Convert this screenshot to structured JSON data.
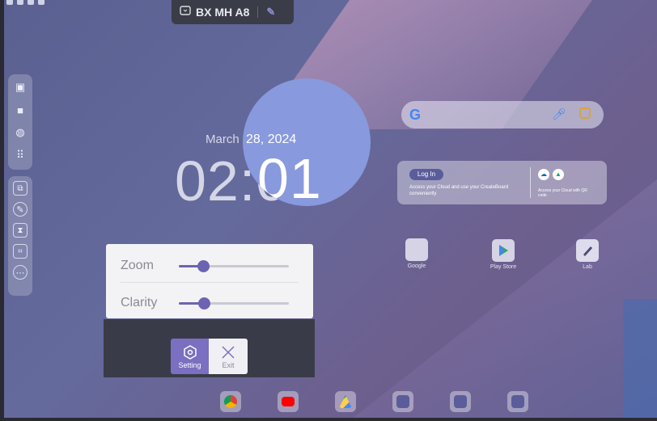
{
  "header": {
    "title": "BX MH A8",
    "title_icon": "presentation-icon",
    "edit_icon": "edit-pencil-icon"
  },
  "sidebar_top": [
    {
      "icon": "note-icon"
    },
    {
      "icon": "folder-icon"
    },
    {
      "icon": "globe-icon"
    },
    {
      "icon": "apps-grid-icon"
    }
  ],
  "sidebar_tools": [
    {
      "icon": "window-icon"
    },
    {
      "icon": "pen-icon"
    },
    {
      "icon": "hourglass-icon"
    },
    {
      "icon": "screenshot-icon"
    },
    {
      "icon": "more-icon"
    }
  ],
  "clock": {
    "date": "March 28, 2024",
    "time": "02:01",
    "magnified_date": "28, 2024",
    "magnified_time": "01"
  },
  "search_widget": {
    "logo": "G",
    "mic_icon": "mic-icon",
    "lens_icon": "lens-icon"
  },
  "cloud_card": {
    "login_label": "Log In",
    "description": "Access your Cloud and use your CreateBoard conveniently",
    "qr_note": "Access your Cloud with QR code"
  },
  "apps": [
    {
      "label": "Google",
      "icon": "google-folder-icon"
    },
    {
      "label": "Play Store",
      "icon": "play-store-icon"
    },
    {
      "label": "Lab",
      "icon": "lab-pen-icon"
    }
  ],
  "magnifier_panel": {
    "zoom_label": "Zoom",
    "zoom_level": 0.22,
    "clarity_label": "Clarity",
    "clarity_level": 0.23
  },
  "toolbar": {
    "setting_label": "Setting",
    "exit_label": "Exit"
  },
  "dock": [
    {
      "icon": "chrome-icon",
      "color": "#db4437"
    },
    {
      "icon": "youtube-icon",
      "color": "#ff0000"
    },
    {
      "icon": "drive-icon",
      "color": "#1fa463"
    },
    {
      "icon": "whiteboard-icon",
      "color": "#5a5d9a"
    },
    {
      "icon": "screen-share-icon",
      "color": "#5a5d9a"
    },
    {
      "icon": "files-icon",
      "color": "#5a5d9a"
    }
  ]
}
